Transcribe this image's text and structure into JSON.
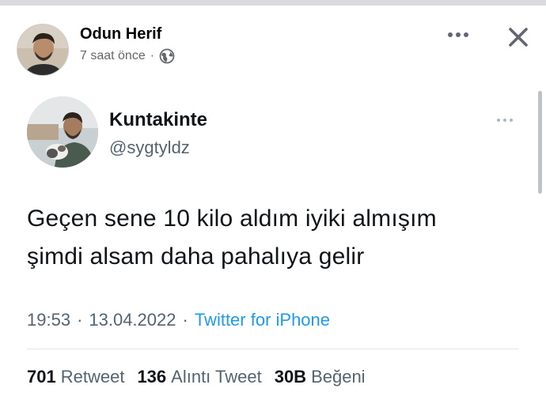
{
  "post": {
    "author": "Odun Herif",
    "time": "7 saat önce",
    "separator": "·",
    "privacy_icon": "globe-icon",
    "more_icon": "more-horizontal-icon",
    "close_icon": "close-icon"
  },
  "tweet": {
    "name": "Kuntakinte",
    "handle": "@sygtyldz",
    "text_lines": [
      "Geçen sene 10 kilo aldım iyiki almışım",
      "şimdi alsam daha pahalıya gelir"
    ],
    "time": "19:53",
    "date": "13.04.2022",
    "separator": "·",
    "source": "Twitter for iPhone",
    "stats": [
      {
        "count": "701",
        "label": "Retweet"
      },
      {
        "count": "136",
        "label": "Alıntı Tweet"
      },
      {
        "count": "30B",
        "label": "Beğeni"
      }
    ]
  },
  "colors": {
    "link": "#1d9bf0",
    "secondary_text": "#536471",
    "fb_secondary": "#65676b"
  }
}
